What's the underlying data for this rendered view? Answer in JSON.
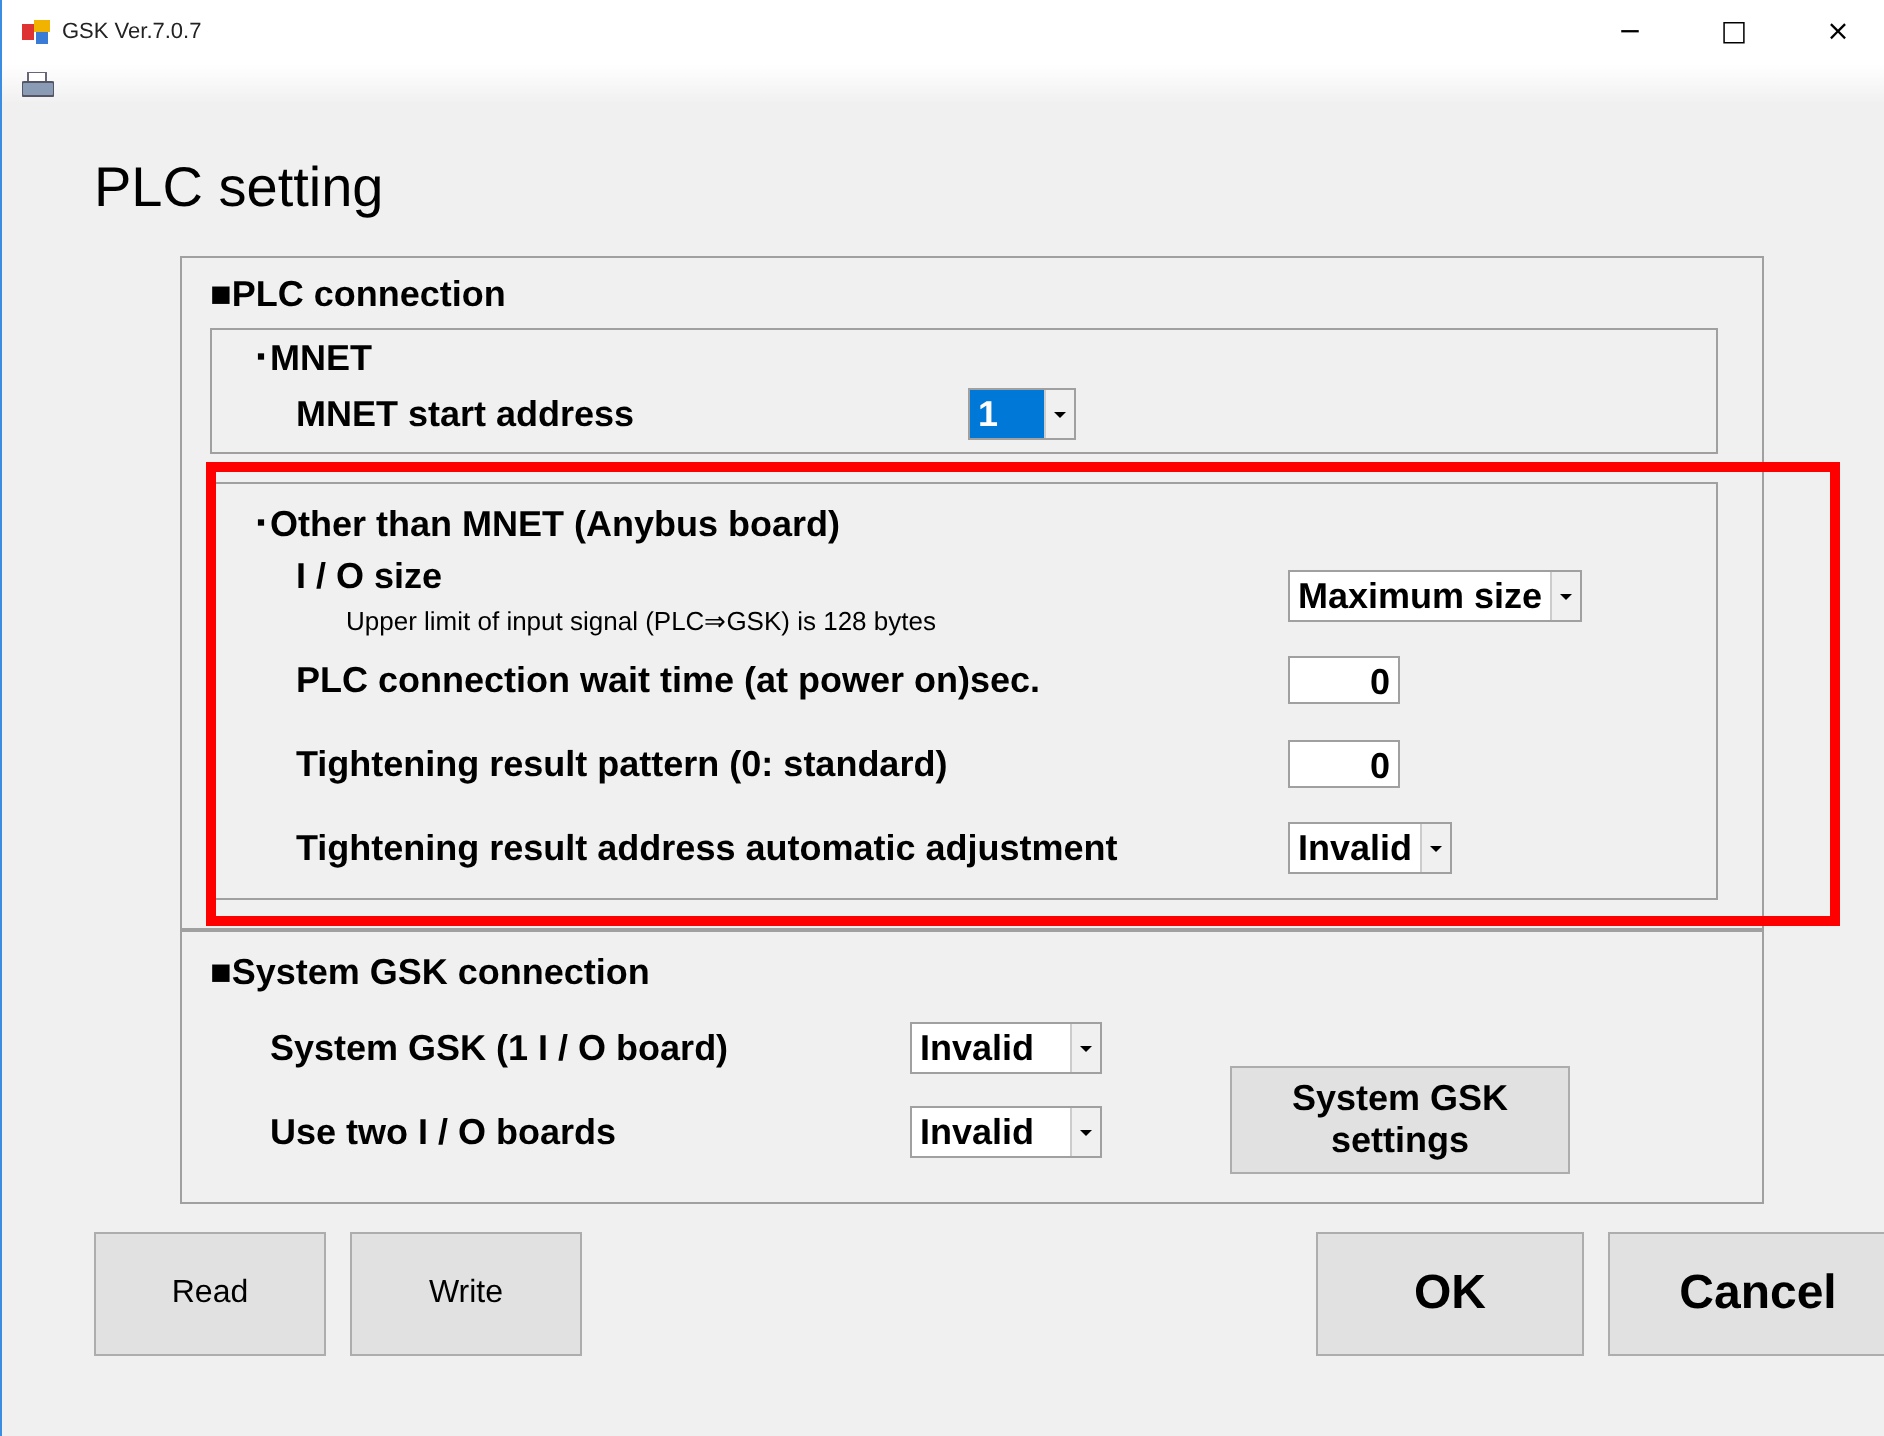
{
  "window": {
    "title": "GSK Ver.7.0.7",
    "controls": [
      "−",
      "□",
      "×"
    ]
  },
  "heading": "PLC setting",
  "plc_connection": {
    "title": "■PLC connection",
    "mnet": {
      "title": "･MNET",
      "start_address": {
        "label": "MNET start address",
        "value": "1",
        "selected": true
      }
    },
    "other": {
      "title": "･Other than MNET (Anybus board)",
      "rows": [
        {
          "kind": "dropdown",
          "label": "I / O size",
          "note": "Upper limit of input signal (PLC⇒GSK) is 128 bytes",
          "value": "Maximum size"
        },
        {
          "kind": "number",
          "label": "PLC connection wait time (at power on)sec.",
          "value": "0"
        },
        {
          "kind": "number",
          "label": "Tightening result pattern (0: standard)",
          "value": "0"
        },
        {
          "kind": "dropdown",
          "label": "Tightening result address automatic adjustment",
          "value": "Invalid"
        }
      ]
    }
  },
  "system_gsk": {
    "title": "■System GSK connection",
    "rows": [
      {
        "label": "System GSK (1 I / O board)",
        "value": "Invalid"
      },
      {
        "label": "Use two I / O boards",
        "value": "Invalid"
      }
    ],
    "button": "System GSK settings"
  },
  "buttons": [
    {
      "label": "Read",
      "kind": "small"
    },
    {
      "label": "Write",
      "kind": "small"
    },
    {
      "label": "OK",
      "kind": "large"
    },
    {
      "label": "Cancel",
      "kind": "large"
    }
  ],
  "annotation": {
    "kind": "frame",
    "color": "#ff0000"
  }
}
